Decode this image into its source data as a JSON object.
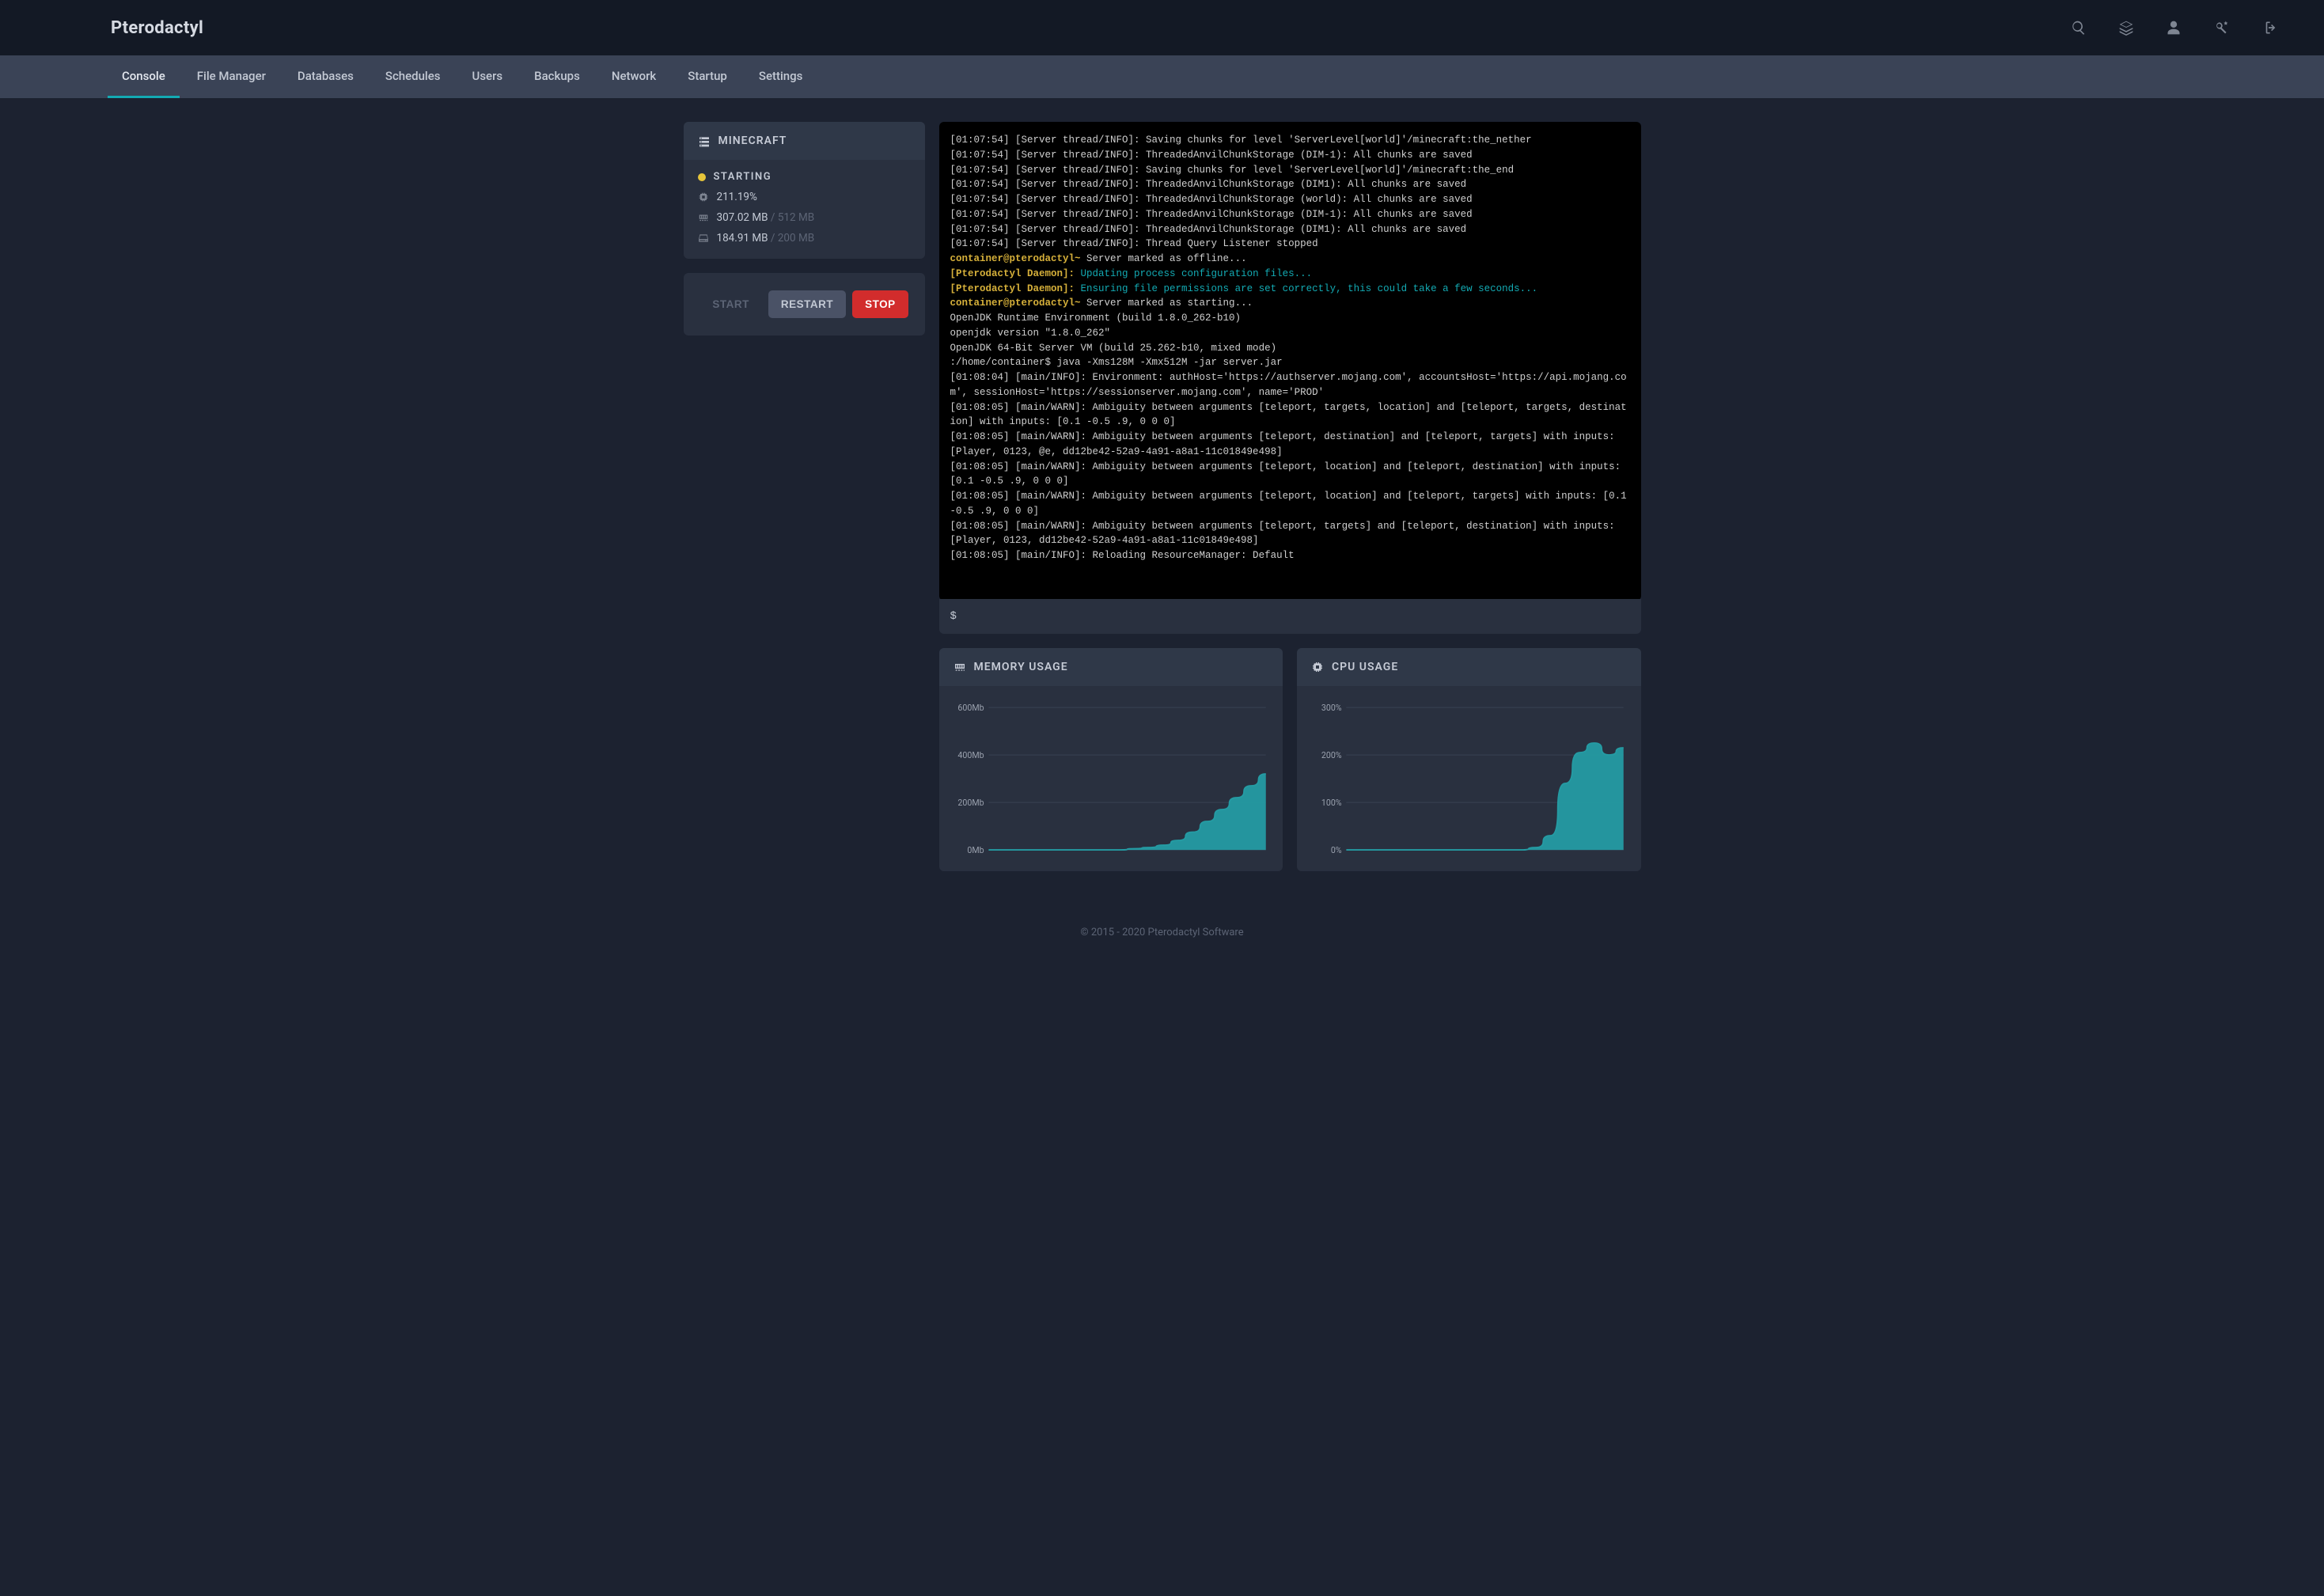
{
  "brand": "Pterodactyl",
  "nav": {
    "tabs": [
      "Console",
      "File Manager",
      "Databases",
      "Schedules",
      "Users",
      "Backups",
      "Network",
      "Startup",
      "Settings"
    ],
    "active": 0
  },
  "server": {
    "name": "MINECRAFT",
    "status": "STARTING",
    "cpu": "211.19%",
    "mem_used": "307.02 MB",
    "mem_limit": "512 MB",
    "disk_used": "184.91 MB",
    "disk_limit": "200 MB"
  },
  "power": {
    "start": "START",
    "restart": "RESTART",
    "stop": "STOP"
  },
  "console_lines": [
    {
      "segs": [
        {
          "t": "[01:07:54] [Server thread/INFO]: Saving chunks for level 'ServerLevel[world]'/minecraft:the_nether"
        }
      ]
    },
    {
      "segs": [
        {
          "t": "[01:07:54] [Server thread/INFO]: ThreadedAnvilChunkStorage (DIM-1): All chunks are saved"
        }
      ]
    },
    {
      "segs": [
        {
          "t": "[01:07:54] [Server thread/INFO]: Saving chunks for level 'ServerLevel[world]'/minecraft:the_end"
        }
      ]
    },
    {
      "segs": [
        {
          "t": "[01:07:54] [Server thread/INFO]: ThreadedAnvilChunkStorage (DIM1): All chunks are saved"
        }
      ]
    },
    {
      "segs": [
        {
          "t": "[01:07:54] [Server thread/INFO]: ThreadedAnvilChunkStorage (world): All chunks are saved"
        }
      ]
    },
    {
      "segs": [
        {
          "t": "[01:07:54] [Server thread/INFO]: ThreadedAnvilChunkStorage (DIM-1): All chunks are saved"
        }
      ]
    },
    {
      "segs": [
        {
          "t": "[01:07:54] [Server thread/INFO]: ThreadedAnvilChunkStorage (DIM1): All chunks are saved"
        }
      ]
    },
    {
      "segs": [
        {
          "t": "[01:07:54] [Server thread/INFO]: Thread Query Listener stopped"
        }
      ]
    },
    {
      "segs": [
        {
          "t": "container@pterodactyl~",
          "c": "c-yellow"
        },
        {
          "t": " Server marked as offline..."
        }
      ]
    },
    {
      "segs": [
        {
          "t": "[Pterodactyl Daemon]:",
          "c": "c-yellow"
        },
        {
          "t": " Updating process configuration files...",
          "c": "c-cyan"
        }
      ]
    },
    {
      "segs": [
        {
          "t": "[Pterodactyl Daemon]:",
          "c": "c-yellow"
        },
        {
          "t": " Ensuring file permissions are set correctly, this could take a few seconds...",
          "c": "c-cyan"
        }
      ]
    },
    {
      "segs": [
        {
          "t": "container@pterodactyl~",
          "c": "c-yellow"
        },
        {
          "t": " Server marked as starting..."
        }
      ]
    },
    {
      "segs": [
        {
          "t": "OpenJDK Runtime Environment (build 1.8.0_262-b10)"
        }
      ]
    },
    {
      "segs": [
        {
          "t": "openjdk version \"1.8.0_262\""
        }
      ]
    },
    {
      "segs": [
        {
          "t": "OpenJDK 64-Bit Server VM (build 25.262-b10, mixed mode)"
        }
      ]
    },
    {
      "segs": [
        {
          "t": ":/home/container$ java -Xms128M -Xmx512M -jar server.jar"
        }
      ]
    },
    {
      "segs": [
        {
          "t": "[01:08:04] [main/INFO]: Environment: authHost='https://authserver.mojang.com', accountsHost='https://api.mojang.com', sessionHost='https://sessionserver.mojang.com', name='PROD'"
        }
      ]
    },
    {
      "segs": [
        {
          "t": "[01:08:05] [main/WARN]: Ambiguity between arguments [teleport, targets, location] and [teleport, targets, destination] with inputs: [0.1 -0.5 .9, 0 0 0]"
        }
      ]
    },
    {
      "segs": [
        {
          "t": "[01:08:05] [main/WARN]: Ambiguity between arguments [teleport, destination] and [teleport, targets] with inputs: [Player, 0123, @e, dd12be42-52a9-4a91-a8a1-11c01849e498]"
        }
      ]
    },
    {
      "segs": [
        {
          "t": "[01:08:05] [main/WARN]: Ambiguity between arguments [teleport, location] and [teleport, destination] with inputs: [0.1 -0.5 .9, 0 0 0]"
        }
      ]
    },
    {
      "segs": [
        {
          "t": "[01:08:05] [main/WARN]: Ambiguity between arguments [teleport, location] and [teleport, targets] with inputs: [0.1 -0.5 .9, 0 0 0]"
        }
      ]
    },
    {
      "segs": [
        {
          "t": "[01:08:05] [main/WARN]: Ambiguity between arguments [teleport, targets] and [teleport, destination] with inputs: [Player, 0123, dd12be42-52a9-4a91-a8a1-11c01849e498]"
        }
      ]
    },
    {
      "segs": [
        {
          "t": "[01:08:05] [main/INFO]: Reloading ResourceManager: Default"
        }
      ]
    }
  ],
  "command_prompt": "$",
  "charts": {
    "memory": {
      "title": "MEMORY USAGE"
    },
    "cpu": {
      "title": "CPU USAGE"
    }
  },
  "chart_data": [
    {
      "type": "area",
      "title": "MEMORY USAGE",
      "ylabel": "Mb",
      "ylim": [
        0,
        600
      ],
      "yticks": [
        {
          "v": 0,
          "l": "0Mb"
        },
        {
          "v": 200,
          "l": "200Mb"
        },
        {
          "v": 400,
          "l": "400Mb"
        },
        {
          "v": 600,
          "l": "600Mb"
        }
      ],
      "x": [
        0,
        1,
        2,
        3,
        4,
        5,
        6,
        7,
        8,
        9,
        10,
        11,
        12,
        13,
        14,
        15,
        16,
        17,
        18,
        19
      ],
      "values": [
        0,
        0,
        0,
        0,
        0,
        0,
        0,
        0,
        0,
        0,
        5,
        10,
        20,
        40,
        75,
        120,
        170,
        220,
        270,
        320
      ]
    },
    {
      "type": "area",
      "title": "CPU USAGE",
      "ylabel": "%",
      "ylim": [
        0,
        300
      ],
      "yticks": [
        {
          "v": 0,
          "l": "0%"
        },
        {
          "v": 100,
          "l": "100%"
        },
        {
          "v": 200,
          "l": "200%"
        },
        {
          "v": 300,
          "l": "300%"
        }
      ],
      "x": [
        0,
        1,
        2,
        3,
        4,
        5,
        6,
        7,
        8,
        9,
        10,
        11,
        12,
        13,
        14,
        15,
        16,
        17,
        18,
        19
      ],
      "values": [
        0,
        0,
        0,
        0,
        0,
        0,
        0,
        0,
        0,
        0,
        0,
        0,
        0,
        5,
        30,
        140,
        205,
        225,
        200,
        215
      ]
    }
  ],
  "footer": "© 2015 - 2020 Pterodactyl Software"
}
